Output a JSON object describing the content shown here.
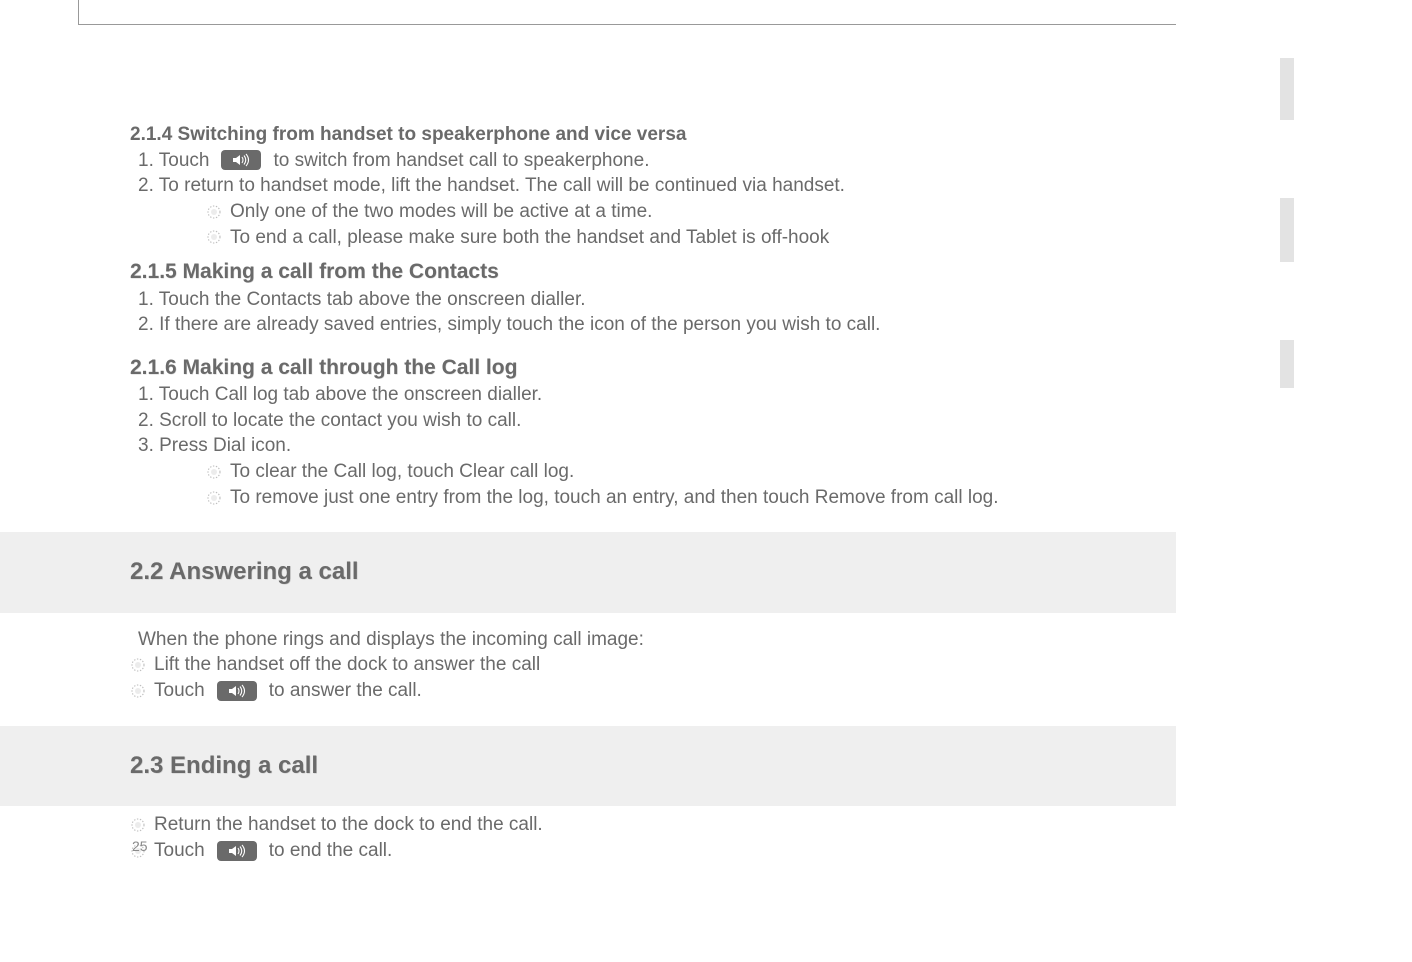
{
  "s214": {
    "heading": "2.1.4 Switching from handset to speakerphone and vice versa",
    "step1a": "1. Touch",
    "step1b": "to switch from handset call to speakerphone.",
    "step2": "2. To return to handset mode, lift the handset. The call will be continued via handset.",
    "tip1": "Only one of the two modes will be active at a time.",
    "tip2": "To end a call, please make sure both the handset and Tablet is off-hook"
  },
  "s215": {
    "heading": "2.1.5 Making a call from the Contacts",
    "step1": "1. Touch the Contacts tab above the onscreen dialler.",
    "step2": "2. If there are already saved entries, simply touch the icon of the person you wish to call."
  },
  "s216": {
    "heading": "2.1.6 Making a call through the Call log",
    "step1": "1. Touch Call log tab above the onscreen dialler.",
    "step2": "2. Scroll to locate the contact you wish to call.",
    "step3": "3. Press Dial icon.",
    "tip1": "To clear the Call log, touch Clear call log.",
    "tip2": "To remove just one entry from the log, touch an entry, and then touch Remove from call log."
  },
  "s22": {
    "heading": "2.2 Answering a call",
    "intro": "When the phone rings and displays the incoming call image:",
    "b1": "Lift the handset off the dock to answer the call",
    "b2a": "Touch",
    "b2b": "to answer the call."
  },
  "s23": {
    "heading": "2.3 Ending a call",
    "b1": "Return the handset to the dock to end the call.",
    "b2a": "Touch",
    "b2b": "to end the call."
  },
  "page_number": "25"
}
